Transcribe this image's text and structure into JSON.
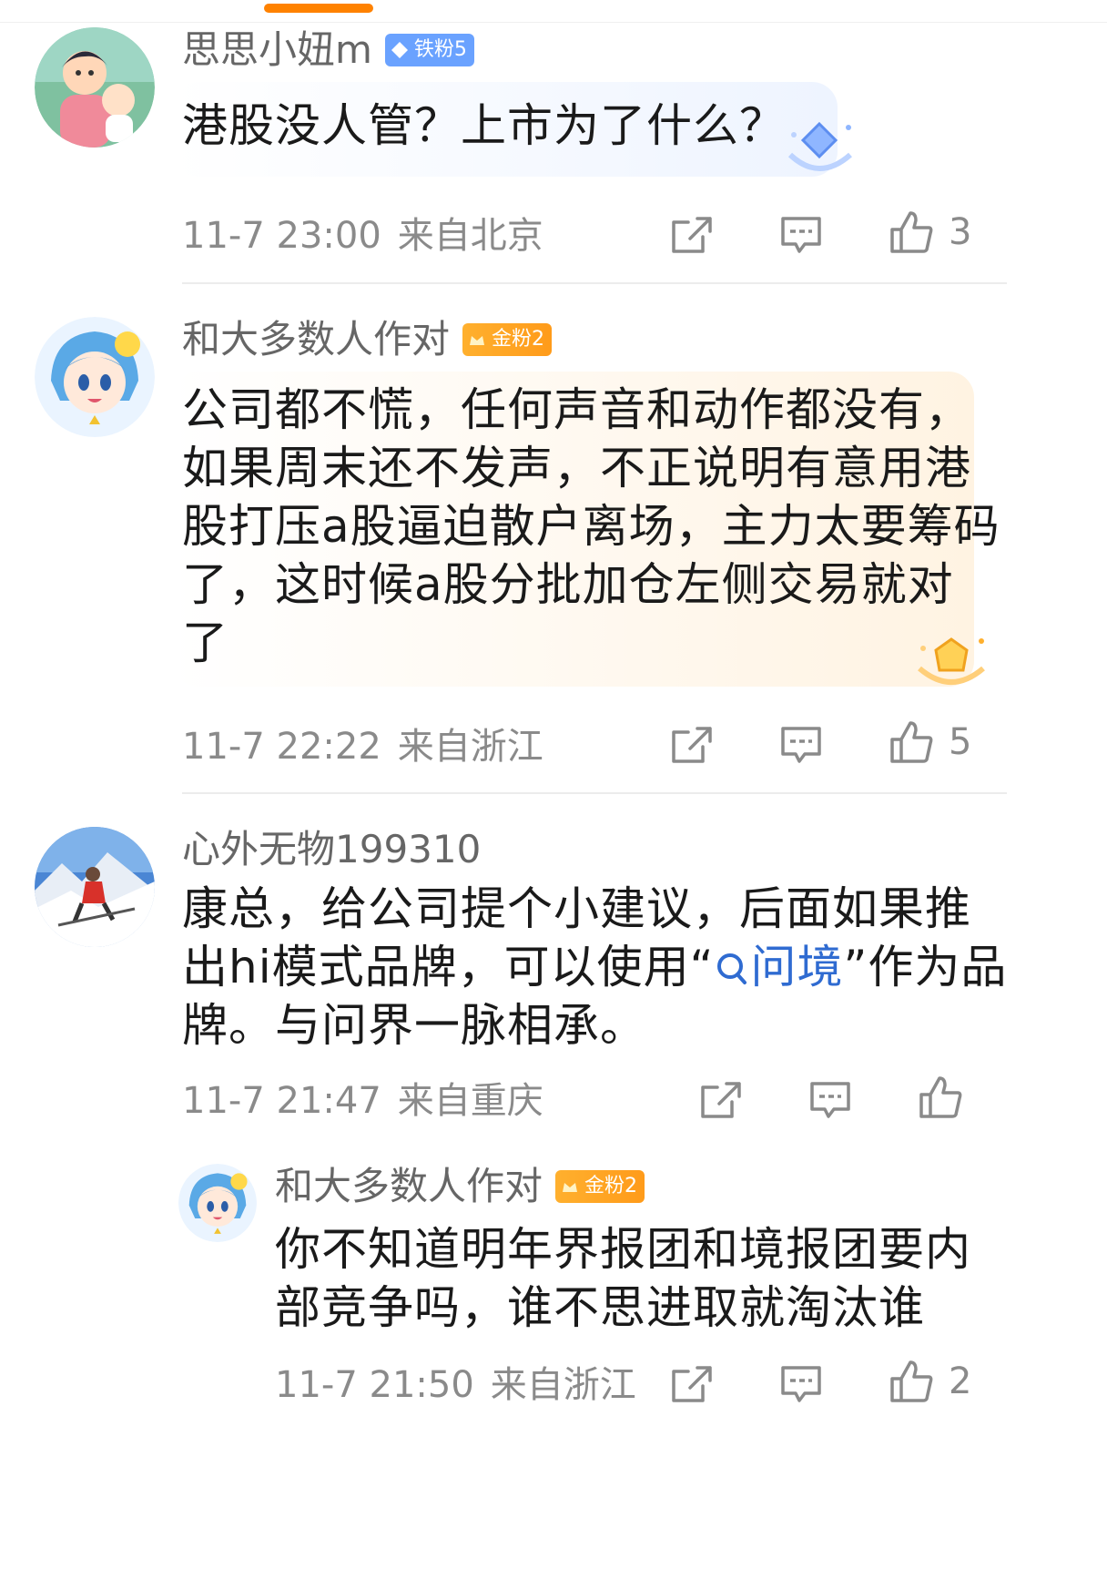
{
  "comments": [
    {
      "username": "思思小妞m",
      "badge": "铁粉5",
      "text": "港股没人管？上市为了什么？",
      "time": "11-7 23:00",
      "location": "来自北京",
      "likes": "3"
    },
    {
      "username": "和大多数人作对",
      "badge": "金粉2",
      "text": "公司都不慌，任何声音和动作都没有，\n如果周末还不发声，不正说明有意用港\n股打压a股逼迫散户离场，主力太要筹码\n了，这时候a股分批加仓左侧交易就对\n了",
      "time": "11-7 22:22",
      "location": "来自浙江",
      "likes": "5"
    },
    {
      "username": "心外无物199310",
      "text_part1": "康总，给公司提个小建议，后面如果推\n出hi模式品牌，可以使用“",
      "link_text": "问境",
      "text_part2": "”作为品\n牌。与问界一脉相承。",
      "time": "11-7 21:47",
      "location": "来自重庆"
    }
  ],
  "reply": {
    "username": "和大多数人作对",
    "badge": "金粉2",
    "text": "你不知道明年界报团和境报团要内\n部竞争吗，谁不思进取就淘汰谁",
    "time": "11-7 21:50",
    "location": "来自浙江",
    "likes": "2"
  },
  "icons": {
    "share": "share-icon",
    "comment": "comment-icon",
    "like": "thumbs-up-icon",
    "search": "search-icon"
  },
  "colors": {
    "accent": "#ff8200",
    "link": "#2f6bd1",
    "iron_badge": "#6aa2ff",
    "gold_badge": "#ffa726"
  }
}
